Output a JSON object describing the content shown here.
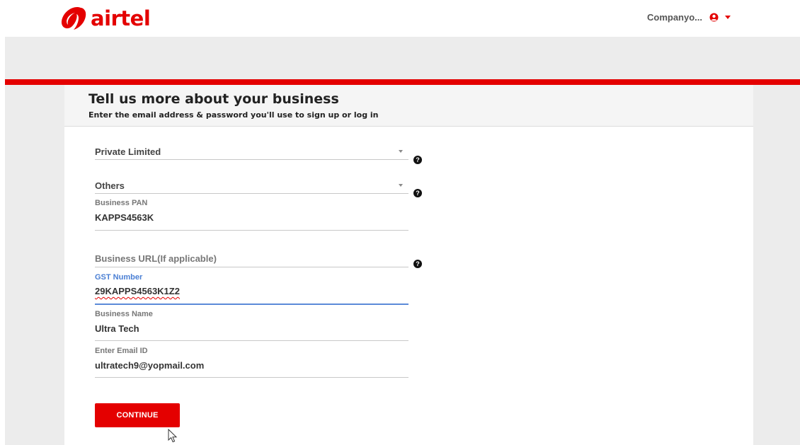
{
  "brand": {
    "name": "airtel",
    "color": "#e40000",
    "logo_icon": "airtel-swirl-icon"
  },
  "account": {
    "label": "Companyo...",
    "avatar_icon": "user-circle-icon",
    "caret_icon": "caret-down-icon"
  },
  "page": {
    "title": "Tell us more about your business",
    "subtitle": "Enter the email address & password you'll use to sign up or log in"
  },
  "form": {
    "company_type": {
      "value": "Private Limited",
      "help_icon": "question-circle-icon"
    },
    "category": {
      "value": "Others",
      "help_icon": "question-circle-icon"
    },
    "business_pan": {
      "label": "Business PAN",
      "value": "KAPPS4563K"
    },
    "business_url": {
      "placeholder": "Business URL(If applicable)",
      "help_icon": "question-circle-icon"
    },
    "gst_number": {
      "label": "GST Number",
      "value": "29KAPPS4563K1Z2"
    },
    "business_name": {
      "label": "Business Name",
      "value": "Ultra Tech"
    },
    "email": {
      "label": "Enter Email ID",
      "value": "ultratech9@yopmail.com"
    },
    "help_glyph": "?"
  },
  "continue_label": "CONTINUE",
  "colors": {
    "accent": "#e40000",
    "focus": "#4a7fd4",
    "band": "#ececec"
  }
}
